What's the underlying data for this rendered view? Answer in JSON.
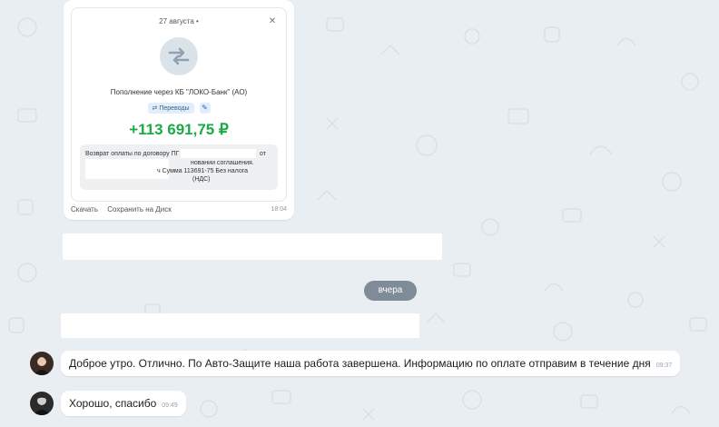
{
  "receipt": {
    "date": "27 августа",
    "date_dot": "•",
    "close_glyph": "✕",
    "title": "Пополнение через КБ \"ЛОКО-Банк\" (АО)",
    "tag_label": "Переводы",
    "tag_icon": "pencil-icon",
    "amount": "+113 691,75 ₽",
    "description": {
      "line1": "Возврат оплаты по договору ПГ",
      "line1_tail": "от",
      "line2": "новании соглашения.",
      "line3": "ч Сумма 113691-75 Без налога",
      "line4": "(НДС)"
    },
    "actions": {
      "download": "Скачать",
      "save": "Сохранить на Диск"
    },
    "time": "18:04"
  },
  "date_separator": "вчера",
  "messages": [
    {
      "text": "Доброе утро. Отлично. По Авто-Защите наша работа завершена. Информацию по оплате отправим в течение дня",
      "time": "09:37"
    },
    {
      "text": "Хорошо, спасибо",
      "time": "09:49"
    }
  ],
  "colors": {
    "amount": "#1aab45",
    "chat_bg": "#e8eef2",
    "date_chip": "#7f8b98"
  }
}
